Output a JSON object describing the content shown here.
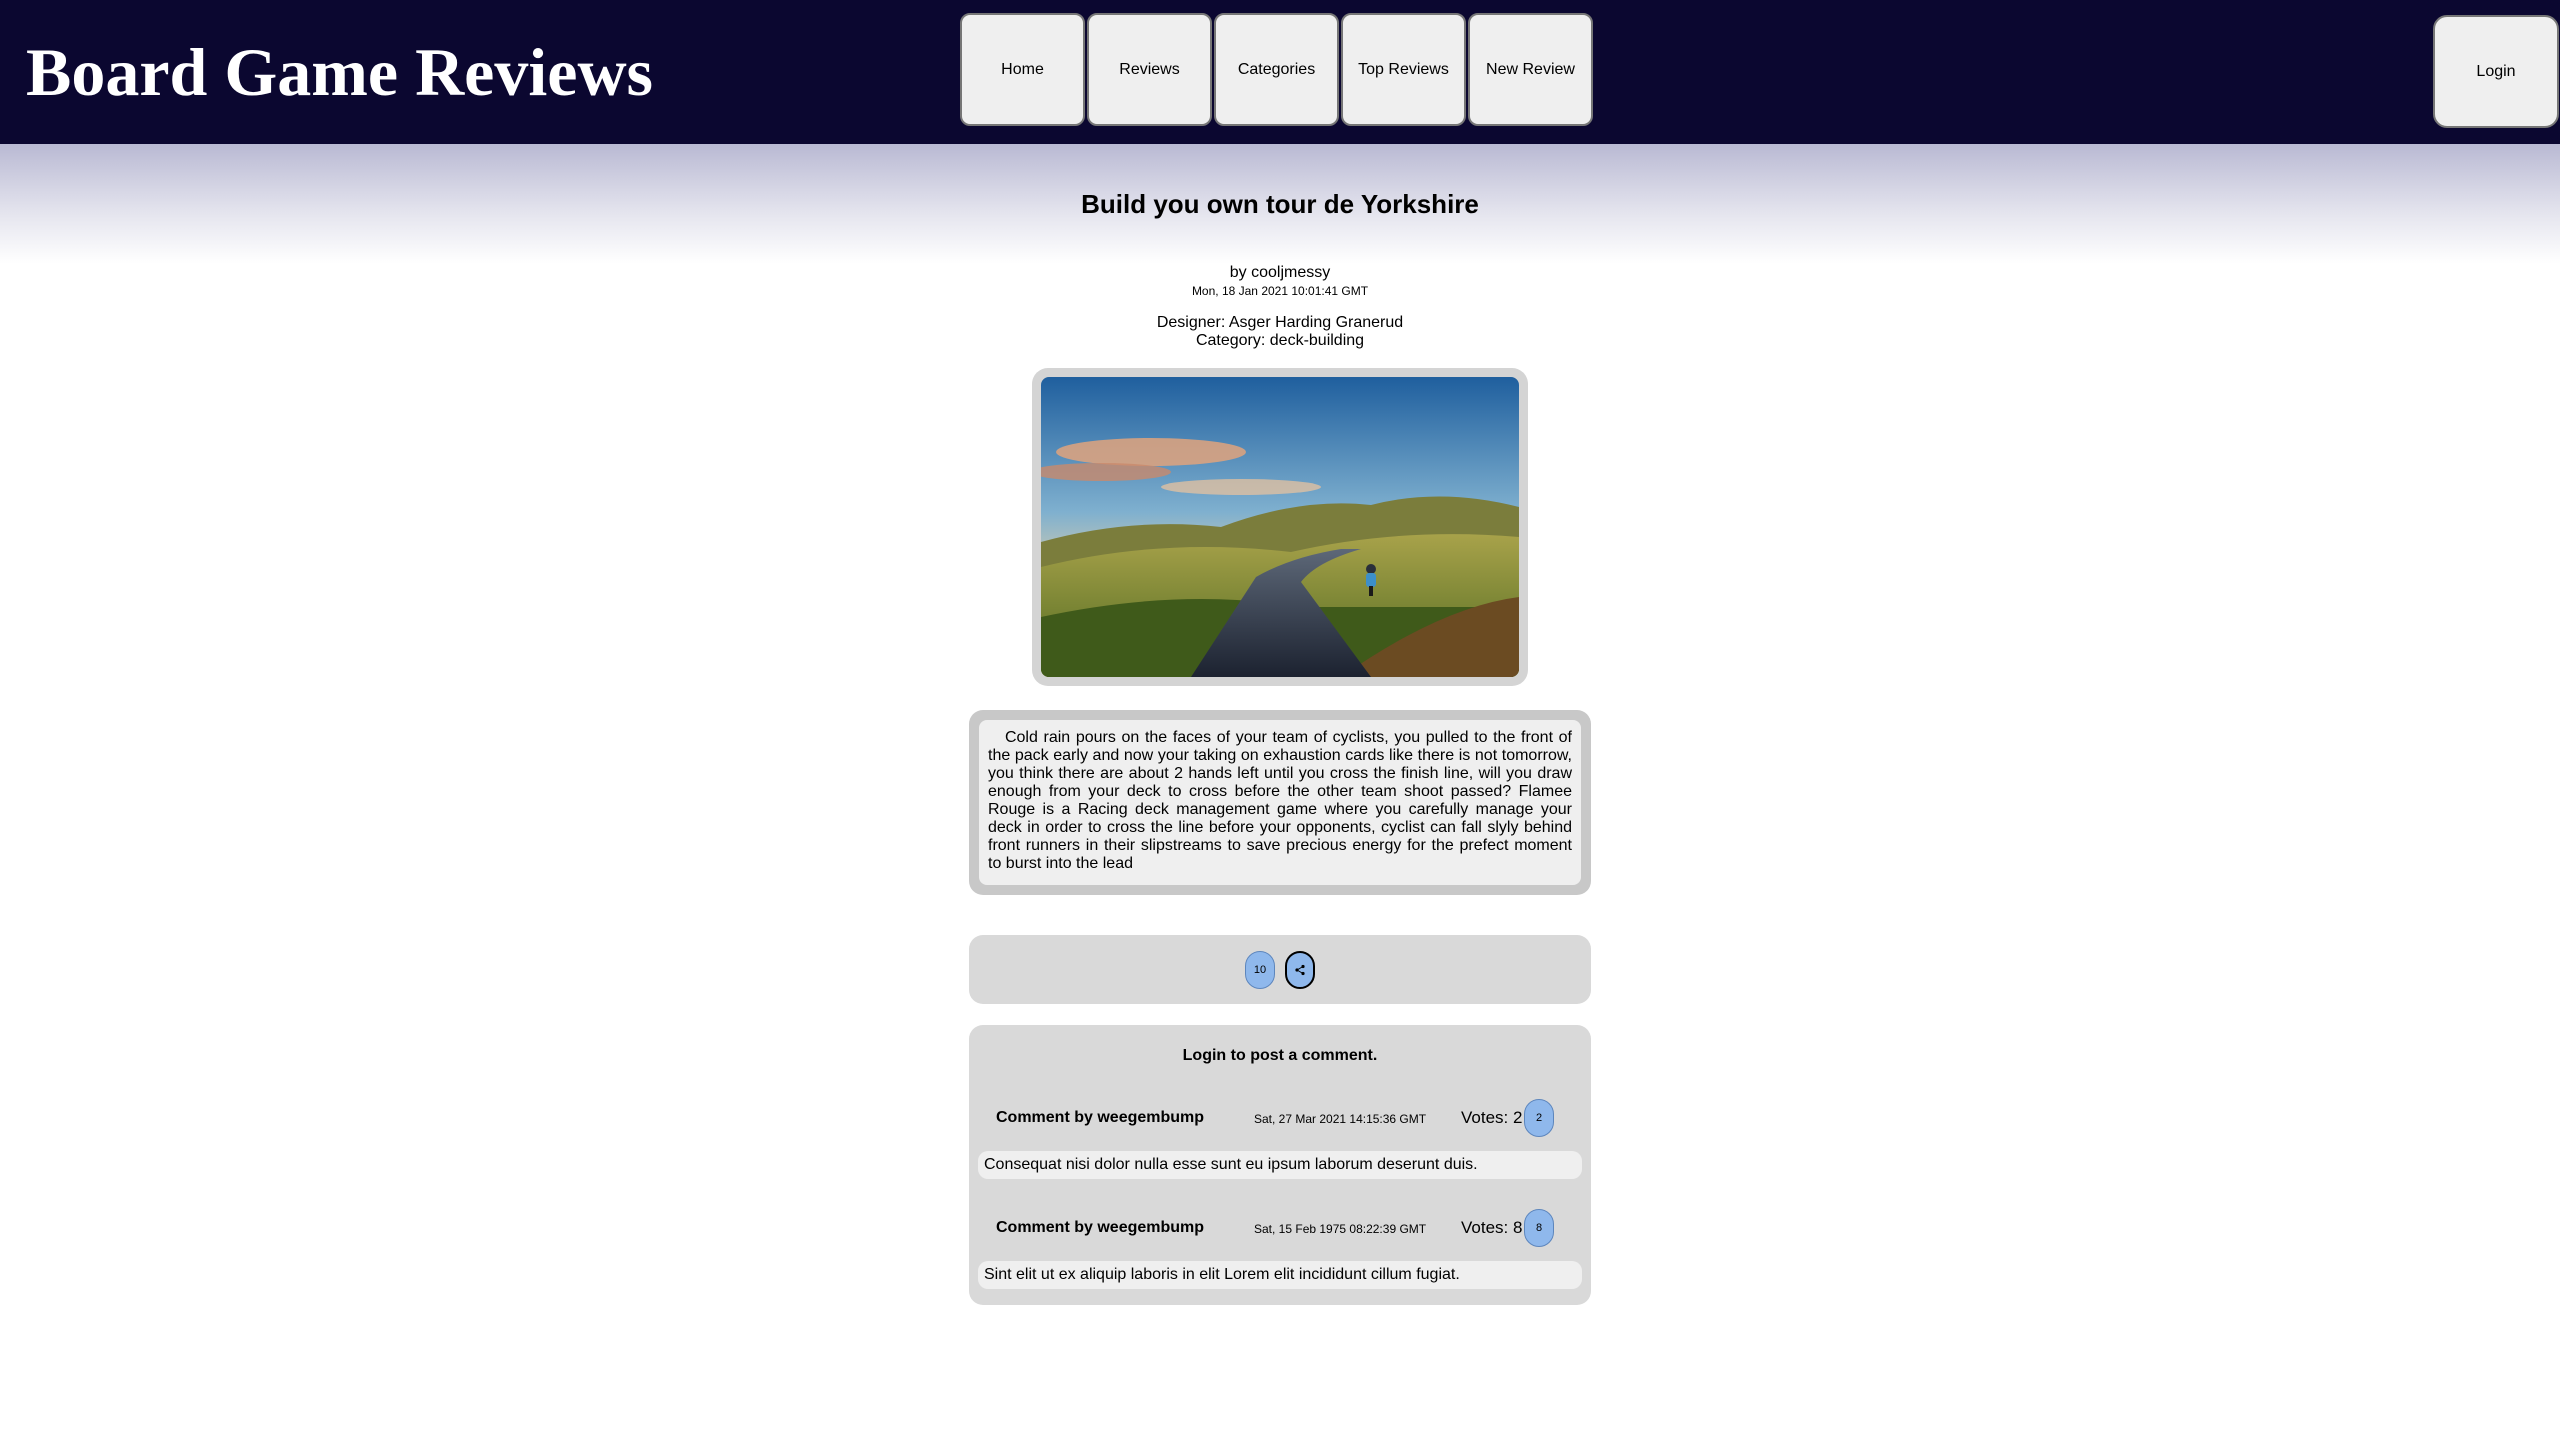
{
  "header": {
    "site_title": "Board Game Reviews",
    "nav": [
      "Home",
      "Reviews",
      "Categories",
      "Top Reviews",
      "New Review"
    ],
    "login_label": "Login"
  },
  "review": {
    "title": "Build you own tour de Yorkshire",
    "byline": "by cooljmessy",
    "date": "Mon, 18 Jan 2021 10:01:41 GMT",
    "designer": "Designer: Asger Harding Granerud",
    "category": "Category: deck-building",
    "image_icon": "cyclist-landscape-photo",
    "body": "Cold rain pours on the faces of your team of cyclists, you pulled to the front of the pack early and now your taking on exhaustion cards like there is not tomorrow, you think there are about 2 hands left until you cross the finish line, will you draw enough from your deck to cross before the other team shoot passed? Flamee Rouge is a Racing deck management game where you carefully manage your deck in order to cross the line before your opponents, cyclist can fall slyly behind front runners in their slipstreams to save precious energy for the prefect moment to burst into the lead"
  },
  "votes": {
    "count": "10",
    "share_icon": "share-icon"
  },
  "comments_section": {
    "login_prompt": "Login to post a comment.",
    "comments": [
      {
        "author": "Comment by weegembump",
        "date": "Sat, 27 Mar 2021 14:15:36 GMT",
        "votes_label": "Votes: 2",
        "vote_button": "2",
        "body": "Consequat nisi dolor nulla esse sunt eu ipsum laborum deserunt duis."
      },
      {
        "author": "Comment by weegembump",
        "date": "Sat, 15 Feb 1975 08:22:39 GMT",
        "votes_label": "Votes: 8",
        "vote_button": "8",
        "body": "Sint elit ut ex aliquip laboris in elit Lorem elit incididunt cillum fugiat."
      }
    ]
  },
  "colors": {
    "header_bg": "#0b0730",
    "pill_blue": "#8fb8ec",
    "panel_grey": "#d9d9d9"
  }
}
